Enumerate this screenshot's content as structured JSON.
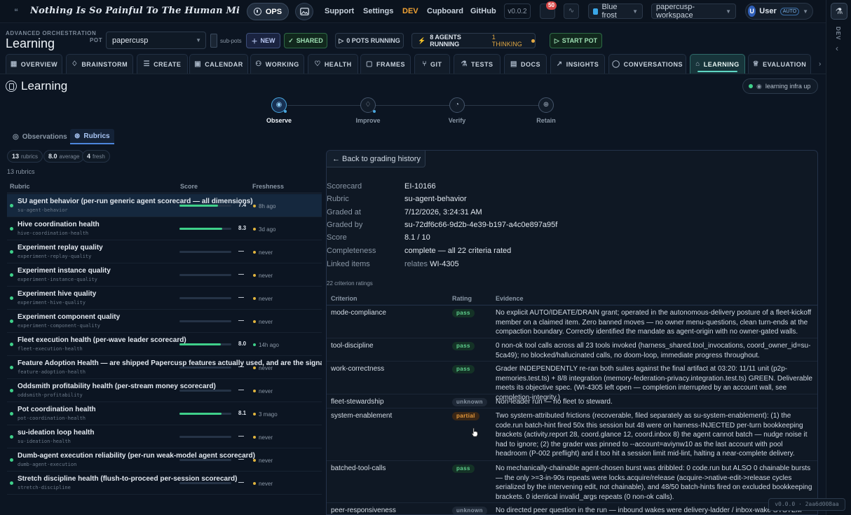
{
  "topbar": {
    "motto": "Nothing Is So Painful To The Human Mind As A Great A...",
    "ops_label": "OPS",
    "nav": [
      "Support",
      "Settings",
      "DEV",
      "Cupboard",
      "GitHub"
    ],
    "version": "v0.0.2",
    "notifications": "50",
    "theme": "Blue frost",
    "workspace": "papercusp-workspace",
    "user_initial": "U",
    "user_name": "User",
    "user_badge": "AUTO"
  },
  "rail": {
    "label": "DEV"
  },
  "header": {
    "breadcrumb": "ADVANCED ORCHESTRATION",
    "title": "Learning",
    "pot_label": "POT",
    "pot_value": "papercusp",
    "subpots_label": "sub-pots",
    "new_label": "NEW",
    "shared_label": "SHARED",
    "pots_running": "0 POTS RUNNING",
    "agents_running": "8 AGENTS RUNNING",
    "thinking": "1 THINKING",
    "start_label": "START POT"
  },
  "tabs": [
    {
      "label": "OVERVIEW",
      "icon": "grid-icon"
    },
    {
      "label": "BRAINSTORM",
      "icon": "bulb-icon"
    },
    {
      "label": "CREATE",
      "icon": "list-plus-icon"
    },
    {
      "label": "CALENDAR",
      "icon": "calendar-icon"
    },
    {
      "label": "WORKING",
      "icon": "users-icon"
    },
    {
      "label": "HEALTH",
      "icon": "heart-icon"
    },
    {
      "label": "FRAMES",
      "icon": "frame-icon"
    },
    {
      "label": "GIT",
      "icon": "branch-icon"
    },
    {
      "label": "TESTS",
      "icon": "flask-icon"
    },
    {
      "label": "DOCS",
      "icon": "book-icon"
    },
    {
      "label": "INSIGHTS",
      "icon": "trend-icon"
    },
    {
      "label": "CONVERSATIONS",
      "icon": "chat-icon"
    },
    {
      "label": "LEARNING",
      "icon": "cap-icon"
    },
    {
      "label": "EVALUATION",
      "icon": "trophy-icon"
    }
  ],
  "page": {
    "title": "Learning",
    "infra": "learning infra up"
  },
  "stepper": [
    "Observe",
    "Improve",
    "Verify",
    "Retain"
  ],
  "subtabs": [
    "Observations",
    "Rubrics"
  ],
  "stats": {
    "rubrics_n": "13",
    "rubrics_l": "rubrics",
    "avg_n": "8.0",
    "avg_l": "average",
    "fresh_n": "4",
    "fresh_l": "fresh",
    "count_line": "13 rubrics"
  },
  "rubric_table": {
    "headers": [
      "Rubric",
      "Score",
      "Freshness"
    ],
    "rows": [
      {
        "name": "SU agent behavior (per-run generic agent scorecard — all dimensions)",
        "slug": "su-agent-behavior",
        "score": "7.4",
        "score_value": 7.4,
        "freshness": "8h ago",
        "fresh": false
      },
      {
        "name": "Hive coordination health",
        "slug": "hive-coordination-health",
        "score": "8.3",
        "score_value": 8.3,
        "freshness": "3d ago",
        "fresh": false
      },
      {
        "name": "Experiment replay quality",
        "slug": "experiment-replay-quality",
        "score": "—",
        "score_value": 0,
        "freshness": "never",
        "fresh": false
      },
      {
        "name": "Experiment instance quality",
        "slug": "experiment-instance-quality",
        "score": "—",
        "score_value": 0,
        "freshness": "never",
        "fresh": false
      },
      {
        "name": "Experiment hive quality",
        "slug": "experiment-hive-quality",
        "score": "—",
        "score_value": 0,
        "freshness": "never",
        "fresh": false
      },
      {
        "name": "Experiment component quality",
        "slug": "experiment-component-quality",
        "score": "—",
        "score_value": 0,
        "freshness": "never",
        "fresh": false
      },
      {
        "name": "Fleet execution health (per-wave leader scorecard)",
        "slug": "fleet-execution-health",
        "score": "8.0",
        "score_value": 8.0,
        "freshness": "14h ago",
        "fresh": true
      },
      {
        "name": "Feature Adoption Health — are shipped Papercusp features actually used, and are the signals that m",
        "slug": "feature-adoption-health",
        "score": "—",
        "score_value": 0,
        "freshness": "never",
        "fresh": false
      },
      {
        "name": "Oddsmith profitability health (per-stream money scorecard)",
        "slug": "oddsmith-profitability",
        "score": "—",
        "score_value": 0,
        "freshness": "never",
        "fresh": false
      },
      {
        "name": "Pot coordination health",
        "slug": "pot-coordination-health",
        "score": "8.1",
        "score_value": 8.1,
        "freshness": "3 mago",
        "fresh": false
      },
      {
        "name": "su-ideation loop health",
        "slug": "su-ideation-health",
        "score": "—",
        "score_value": 0,
        "freshness": "never",
        "fresh": false
      },
      {
        "name": "Dumb-agent execution reliability (per-run weak-model agent scorecard)",
        "slug": "dumb-agent-execution",
        "score": "—",
        "score_value": 0,
        "freshness": "never",
        "fresh": false
      },
      {
        "name": "Stretch discipline health (flush-to-proceed per-session scorecard)",
        "slug": "stretch-discipline",
        "score": "—",
        "score_value": 0,
        "freshness": "never",
        "fresh": false
      }
    ]
  },
  "detail": {
    "back_label": "← Back to grading history",
    "fields": [
      {
        "k": "Scorecard",
        "v": "EI-10166"
      },
      {
        "k": "Rubric",
        "v": "su-agent-behavior"
      },
      {
        "k": "Graded at",
        "v": "7/12/2026, 3:24:31 AM"
      },
      {
        "k": "Graded by",
        "v": "su-72df6c66-9d2b-4e39-b197-a4c0e897a95f"
      },
      {
        "k": "Score",
        "v": "8.1 / 10"
      },
      {
        "k": "Completeness",
        "v": "complete — all 22 criteria rated"
      }
    ],
    "linked_k": "Linked items",
    "linked_rel": "relates",
    "linked_v": "WI-4305",
    "criteria_count": "22 criterion ratings",
    "criteria_headers": [
      "Criterion",
      "Rating",
      "Evidence"
    ],
    "criteria": [
      {
        "name": "mode-compliance",
        "rating": "pass",
        "evidence": "No explicit AUTO/IDEATE/DRAIN grant; operated in the autonomous-delivery posture of a fleet-kickoff member on a claimed item. Zero banned moves — no owner menu-questions, clean turn-ends at the compaction boundary. Correctly identified the mandate as agent-origin with no owner-gated walls."
      },
      {
        "name": "tool-discipline",
        "rating": "pass",
        "evidence": "0 non-ok tool calls across all 23 tools invoked (harness_shared.tool_invocations, coord_owner_id=su-5ca49); no blocked/hallucinated calls, no doom-loop, immediate progress throughout."
      },
      {
        "name": "work-correctness",
        "rating": "pass",
        "evidence": "Grader INDEPENDENTLY re-ran both suites against the final artifact at 03:20: 11/11 unit (p2p-memories.test.ts) + 8/8 integration (memory-federation-privacy.integration.test.ts) GREEN. Deliverable meets its objective spec. (WI-4305 left open — completion interrupted by an account wall, see completion-integrity.)"
      },
      {
        "name": "fleet-stewardship",
        "rating": "unknown",
        "evidence": "Non-leader run — no fleet to steward."
      },
      {
        "name": "system-enablement",
        "rating": "partial",
        "evidence": "Two system-attributed frictions (recoverable, filed separately as su-system-enablement): (1) the code.run batch-hint fired 50x this session but 48 were on harness-INJECTED per-turn bookkeeping brackets (activity.report 28, coord.glance 12, coord.inbox 8) the agent cannot batch — nudge noise it had to ignore; (2) the grader was pinned to --account=aviynw10 as the last account with pool headroom (P-002 preflight) and it too hit a session limit mid-lint, halting a near-complete delivery."
      },
      {
        "name": "batched-tool-calls",
        "rating": "pass",
        "evidence": "No mechanically-chainable agent-chosen burst was dribbled: 0 code.run but ALSO 0 chainable bursts — the only >=3-in-90s repeats were locks.acquire/release (acquire->native-edit->release cycles serialized by the intervening edit, not chainable), and 48/50 batch-hints fired on excluded bookkeeping brackets. 0 identical invalid_args repeats (0 non-ok calls)."
      },
      {
        "name": "peer-responsiveness",
        "rating": "unknown",
        "evidence": "No directed peer question in the run — inbound wakes were delivery-ladder / inbox-wake SYSTEM notifications, not peer questions."
      }
    ]
  },
  "footer": {
    "version": "v0.0.0 · 2aa6d008aa"
  }
}
